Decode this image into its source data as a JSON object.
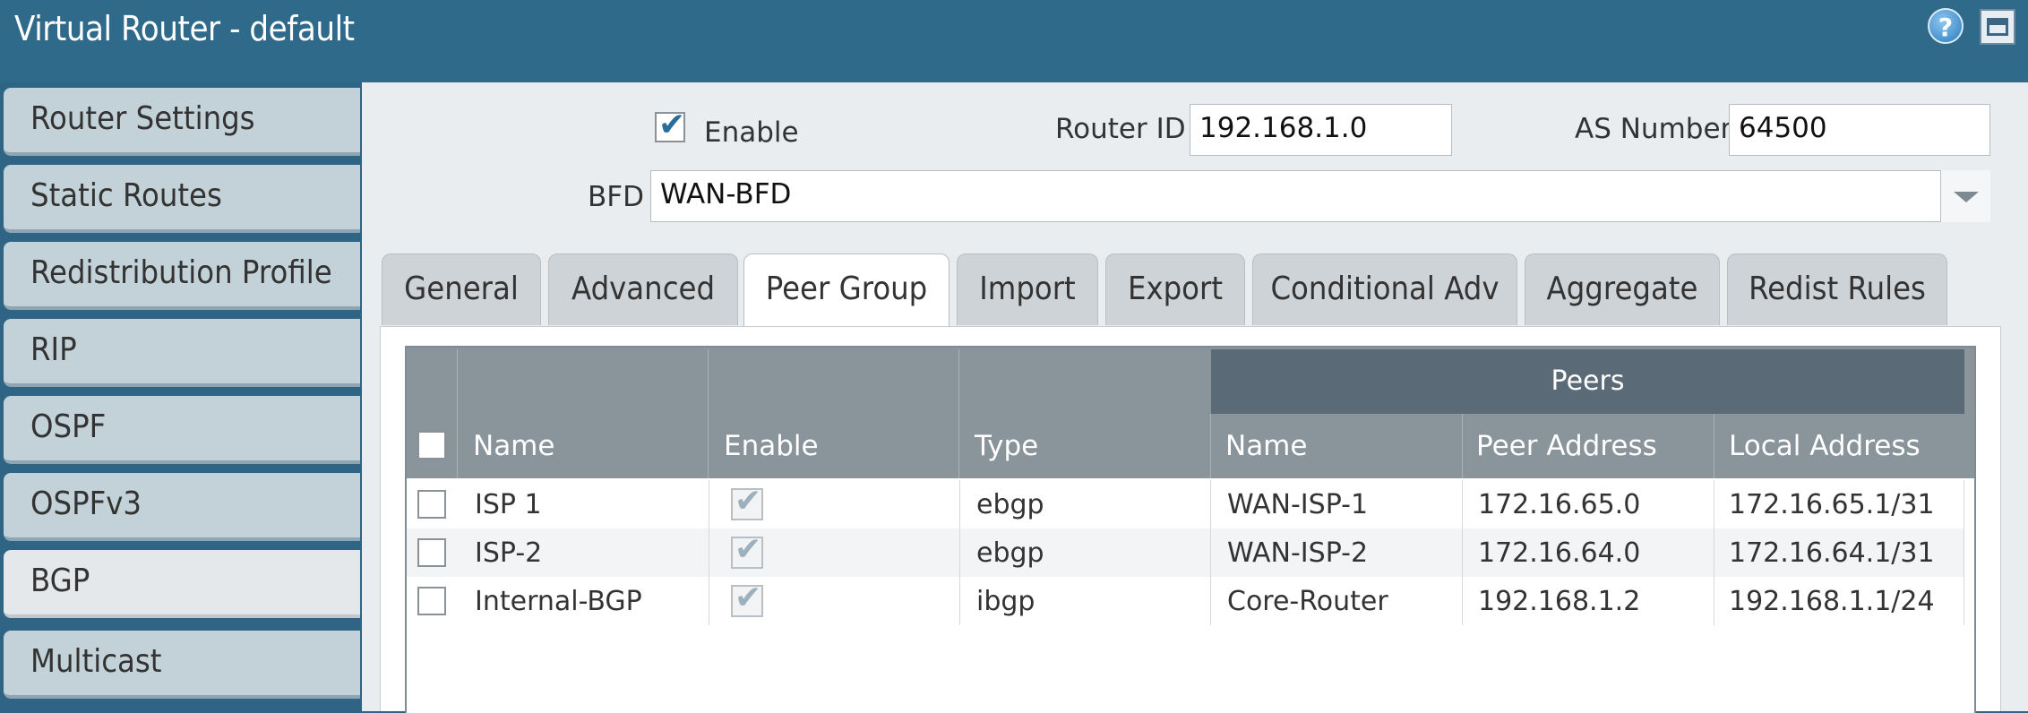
{
  "window": {
    "title": "Virtual Router - default"
  },
  "sidebar": {
    "items": [
      {
        "label": "Router Settings"
      },
      {
        "label": "Static Routes"
      },
      {
        "label": "Redistribution Profile"
      },
      {
        "label": "RIP"
      },
      {
        "label": "OSPF"
      },
      {
        "label": "OSPFv3"
      },
      {
        "label": "BGP",
        "active": true
      },
      {
        "label": "Multicast"
      }
    ]
  },
  "form": {
    "enable_label": "Enable",
    "enable_checked": true,
    "router_id_label": "Router ID",
    "router_id_value": "192.168.1.0",
    "as_number_label": "AS Number",
    "as_number_value": "64500",
    "bfd_label": "BFD",
    "bfd_value": "WAN-BFD"
  },
  "tabs": [
    {
      "label": "General"
    },
    {
      "label": "Advanced"
    },
    {
      "label": "Peer Group",
      "active": true
    },
    {
      "label": "Import"
    },
    {
      "label": "Export"
    },
    {
      "label": "Conditional Adv"
    },
    {
      "label": "Aggregate"
    },
    {
      "label": "Redist Rules"
    }
  ],
  "table": {
    "group_header": "Peers",
    "columns": [
      "Name",
      "Enable",
      "Type",
      "Name",
      "Peer Address",
      "Local Address"
    ],
    "rows": [
      {
        "name": "ISP 1",
        "enable": true,
        "type": "ebgp",
        "peer_name": "WAN-ISP-1",
        "peer_address": "172.16.65.0",
        "local_address": "172.16.65.1/31"
      },
      {
        "name": "ISP-2",
        "enable": true,
        "type": "ebgp",
        "peer_name": "WAN-ISP-2",
        "peer_address": "172.16.64.0",
        "local_address": "172.16.64.1/31"
      },
      {
        "name": "Internal-BGP",
        "enable": true,
        "type": "ibgp",
        "peer_name": "Core-Router",
        "peer_address": "192.168.1.2",
        "local_address": "192.168.1.1/24"
      }
    ]
  },
  "icons": {
    "help": "help-icon",
    "minimize": "minimize-icon"
  },
  "colors": {
    "titlebar": "#2f6a8a",
    "header": "#8a949b",
    "peers_header": "#5a6a76"
  }
}
